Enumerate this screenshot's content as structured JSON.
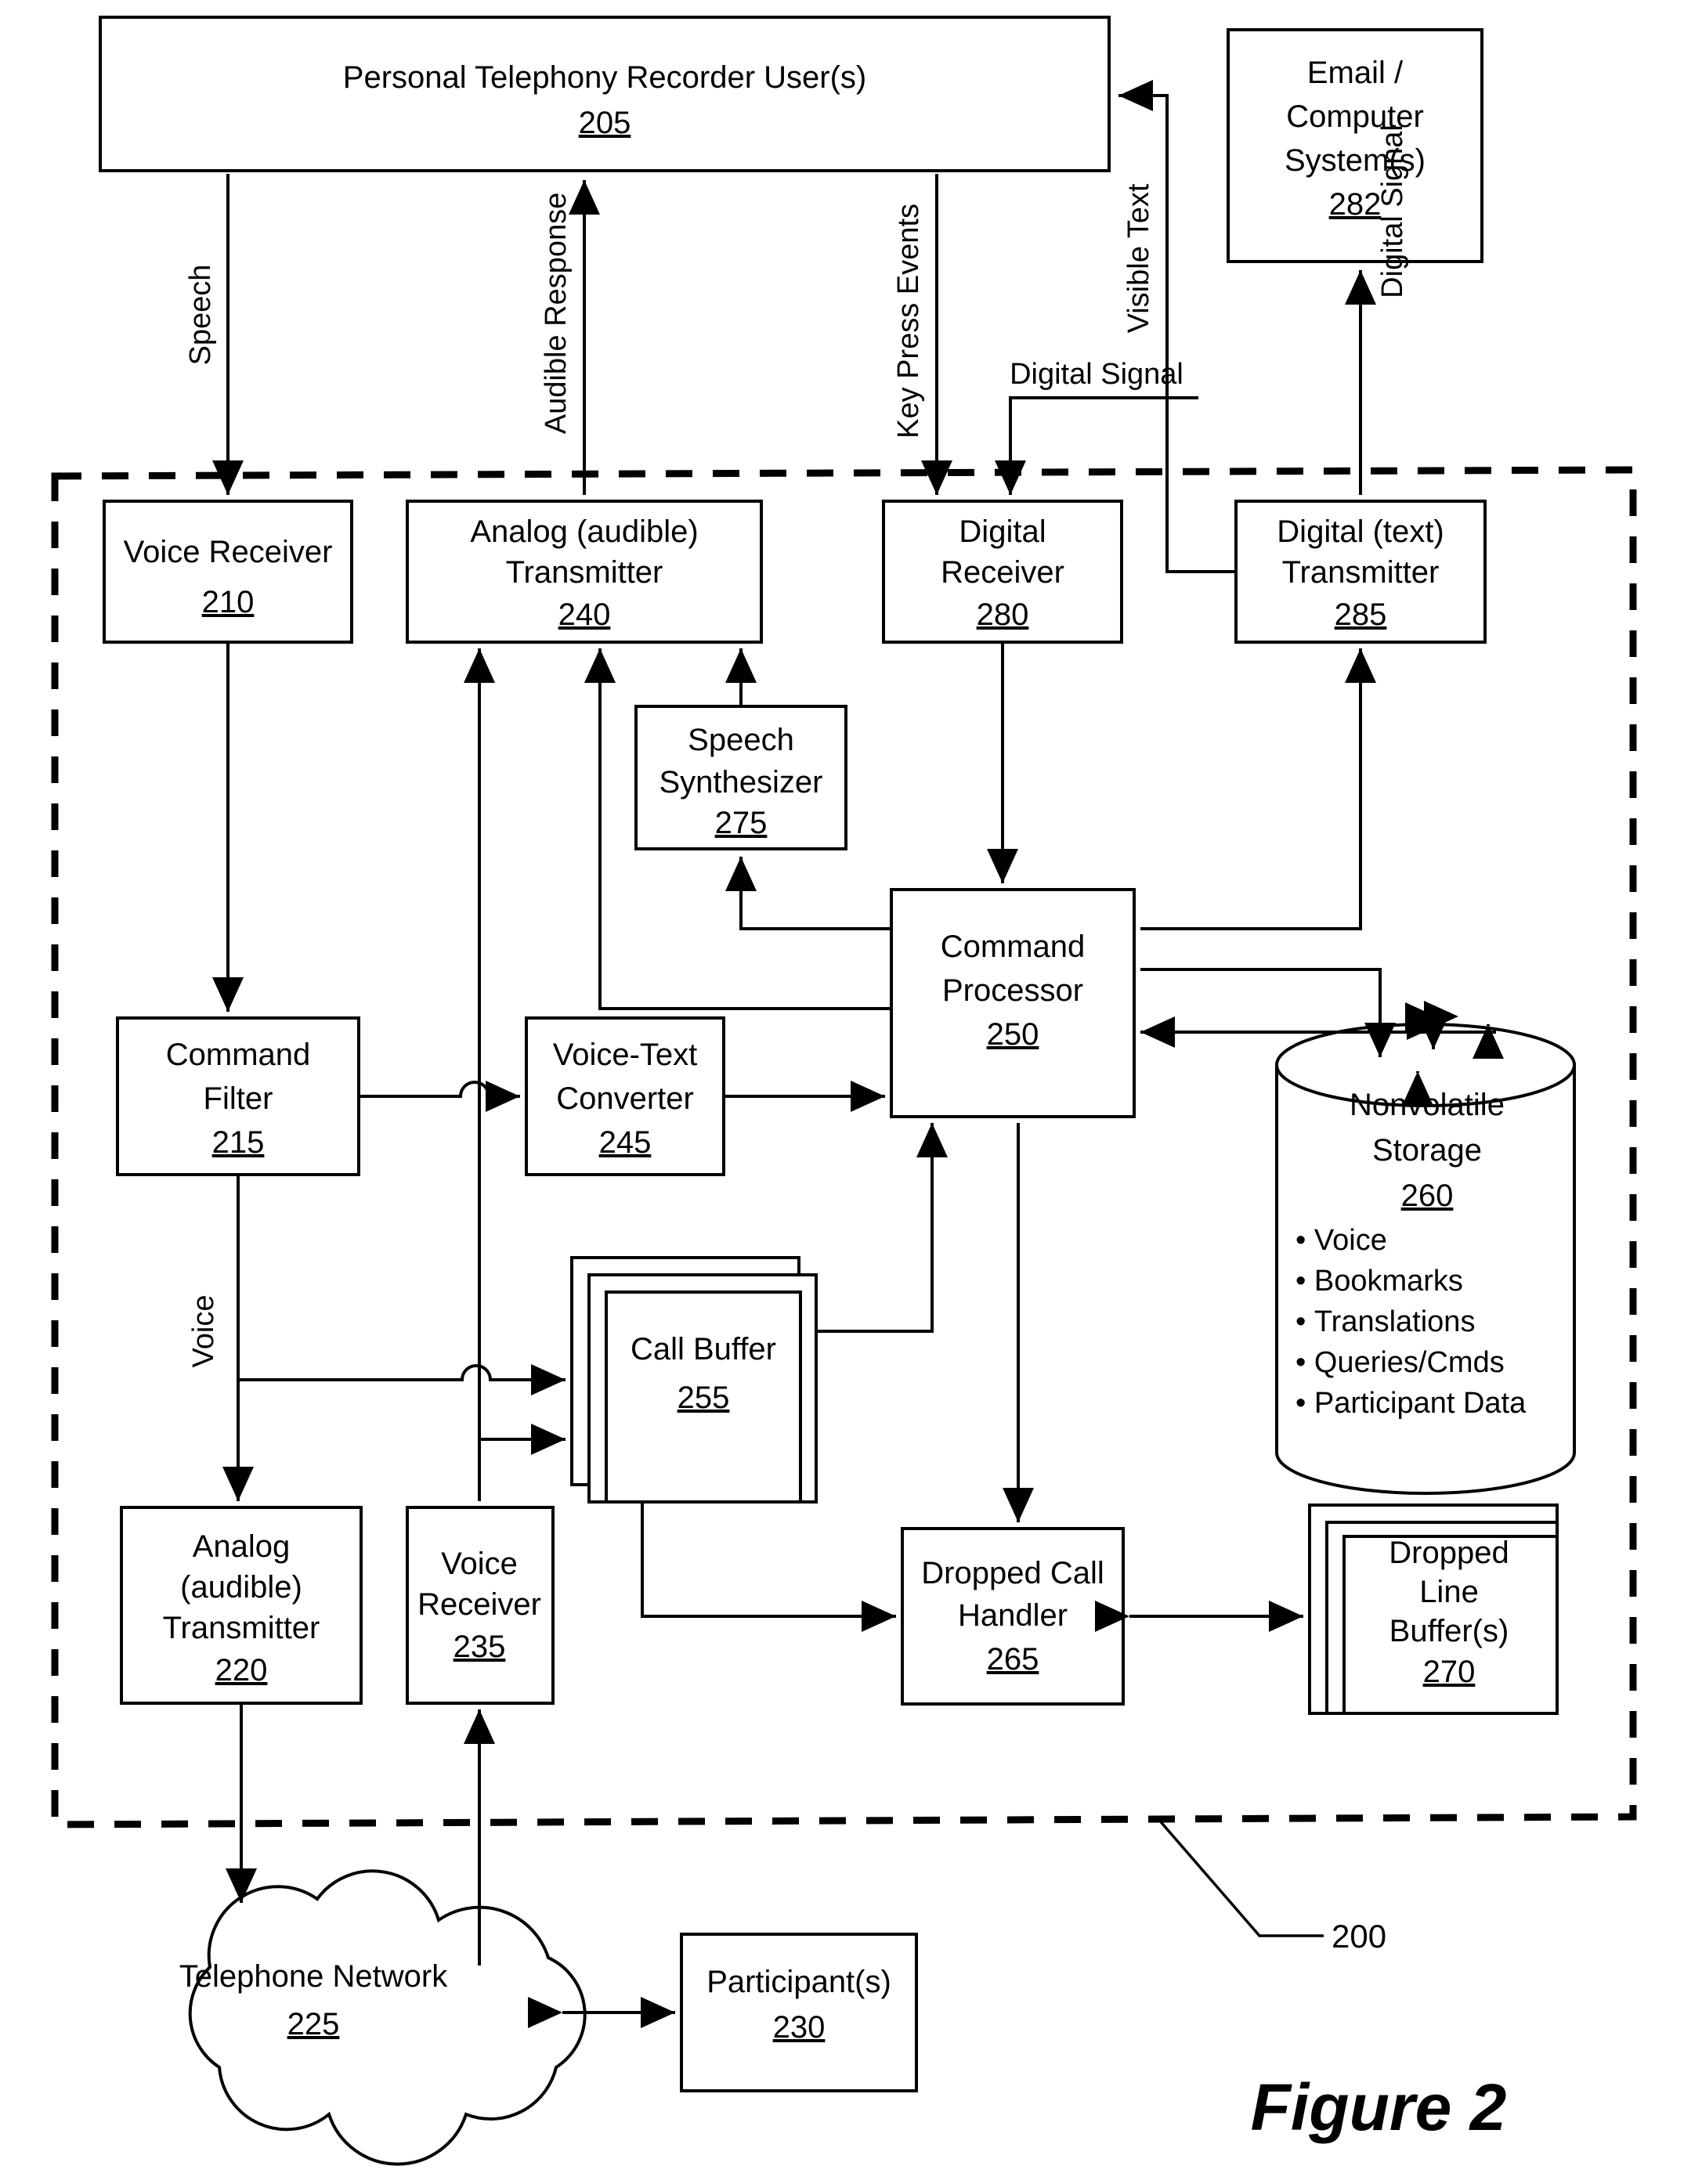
{
  "figure": {
    "caption": "Figure 2",
    "system_ref": "200"
  },
  "nodes": {
    "user": {
      "lines": [
        "Personal Telephony Recorder User(s)"
      ],
      "ref": "205"
    },
    "email": {
      "lines": [
        "Email /",
        "Computer",
        "System(s)"
      ],
      "ref": "282"
    },
    "voice_receiver_210": {
      "lines": [
        "Voice Receiver"
      ],
      "ref": "210"
    },
    "analog_tx_240": {
      "lines": [
        "Analog (audible)",
        "Transmitter"
      ],
      "ref": "240"
    },
    "digital_rx_280": {
      "lines": [
        "Digital",
        "Receiver"
      ],
      "ref": "280"
    },
    "digital_tx_285": {
      "lines": [
        "Digital (text)",
        "Transmitter"
      ],
      "ref": "285"
    },
    "speech_synth_275": {
      "lines": [
        "Speech",
        "Synthesizer"
      ],
      "ref": "275"
    },
    "command_processor_250": {
      "lines": [
        "Command",
        "Processor"
      ],
      "ref": "250"
    },
    "command_filter_215": {
      "lines": [
        "Command",
        "Filter"
      ],
      "ref": "215"
    },
    "voice_text_245": {
      "lines": [
        "Voice-Text",
        "Converter"
      ],
      "ref": "245"
    },
    "nonvolatile_260": {
      "lines": [
        "Nonvolatile",
        "Storage"
      ],
      "ref": "260",
      "bullets": [
        "Voice",
        "Bookmarks",
        "Translations",
        "Queries/Cmds",
        "Participant Data"
      ]
    },
    "call_buffer_255": {
      "lines": [
        "Call Buffer"
      ],
      "ref": "255"
    },
    "analog_tx_220": {
      "lines": [
        "Analog",
        "(audible)",
        "Transmitter"
      ],
      "ref": "220"
    },
    "voice_receiver_235": {
      "lines": [
        "Voice",
        "Receiver"
      ],
      "ref": "235"
    },
    "dropped_call_handler_265": {
      "lines": [
        "Dropped Call",
        "Handler"
      ],
      "ref": "265"
    },
    "dropped_line_buffer_270": {
      "lines": [
        "Dropped",
        "Line",
        "Buffer(s)"
      ],
      "ref": "270"
    },
    "telephone_network_225": {
      "lines": [
        "Telephone Network"
      ],
      "ref": "225"
    },
    "participants_230": {
      "lines": [
        "Participant(s)"
      ],
      "ref": "230"
    }
  },
  "edge_labels": {
    "speech": "Speech",
    "audible_response": "Audible Response",
    "key_press_events": "Key Press Events",
    "visible_text": "Visible Text",
    "digital_signal_left": "Digital Signal",
    "digital_signal_right": "Digital Signal",
    "voice": "Voice"
  }
}
